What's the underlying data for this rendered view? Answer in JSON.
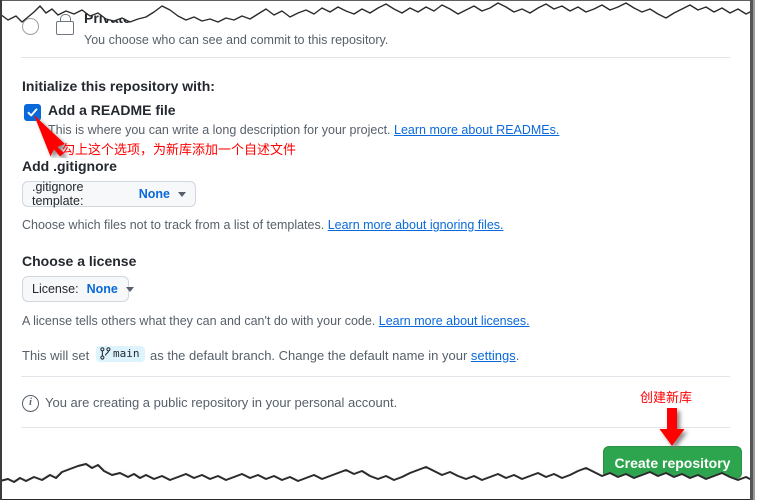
{
  "form": {
    "visibility": {
      "option_label": "Private",
      "option_description": "You choose who can see and commit to this repository.",
      "radio_state": "unselected",
      "icon": "lock-icon"
    },
    "initialize": {
      "heading": "Initialize this repository with:",
      "readme": {
        "label": "Add a README file",
        "checked": true,
        "helper_text": "This is where you can write a long description for your project.",
        "helper_link": "Learn more about READMEs."
      }
    },
    "gitignore": {
      "heading": "Add .gitignore",
      "dropdown_prefix": ".gitignore template:",
      "dropdown_value": "None",
      "helper_text": "Choose which files not to track from a list of templates.",
      "helper_link": "Learn more about ignoring files."
    },
    "license": {
      "heading": "Choose a license",
      "dropdown_prefix": "License:",
      "dropdown_value": "None",
      "helper_text": "A license tells others what they can and can't do with your code.",
      "helper_link": "Learn more about licenses."
    },
    "default_branch": {
      "text_before": "This will set",
      "branch_name": "main",
      "branch_icon": "git-branch-icon",
      "text_after": "as the default branch. Change the default name in your",
      "settings_link": "settings",
      "period": "."
    },
    "notice": {
      "icon": "info-icon",
      "text": "You are creating a public repository in your personal account."
    },
    "submit": {
      "label": "Create repository"
    }
  },
  "annotations": {
    "readme_note": "勾上这个选项，为新库添加一个自述文件",
    "create_note": "创建新库",
    "arrow_color": "#ff0000"
  },
  "colors": {
    "accent_blue": "#0969da",
    "button_green": "#2da44e",
    "annotation_red": "#ff0000",
    "text_primary": "#24292f",
    "text_muted": "#57606a",
    "divider": "#e1e4e8",
    "branch_badge_bg": "#ddf4ff"
  }
}
